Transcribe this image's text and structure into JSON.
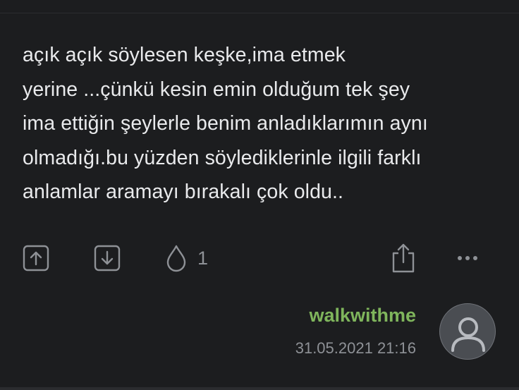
{
  "post": {
    "text": "açık açık söylesen keşke,ima etmek\nyerine ...çünkü kesin emin olduğum tek şey\nima ettiğin şeylerle benim anladıklarımın aynı\nolmadığı.bu yüzden söylediklerinle ilgili farklı\nanlamlar aramayı bırakalı çok oldu.."
  },
  "actions": {
    "upvote_icon": "arrow-up-box-icon",
    "downvote_icon": "arrow-down-box-icon",
    "favorite_icon": "drop-icon",
    "favorite_count": "1",
    "share_icon": "share-icon",
    "more_icon": "more-dots-icon"
  },
  "author": {
    "username": "walkwithme",
    "timestamp": "31.05.2021 21:16",
    "avatar_icon": "user-avatar-icon"
  },
  "colors": {
    "background": "#1c1d1f",
    "text": "#e9eaec",
    "muted": "#8e9196",
    "username": "#7fb55c"
  }
}
